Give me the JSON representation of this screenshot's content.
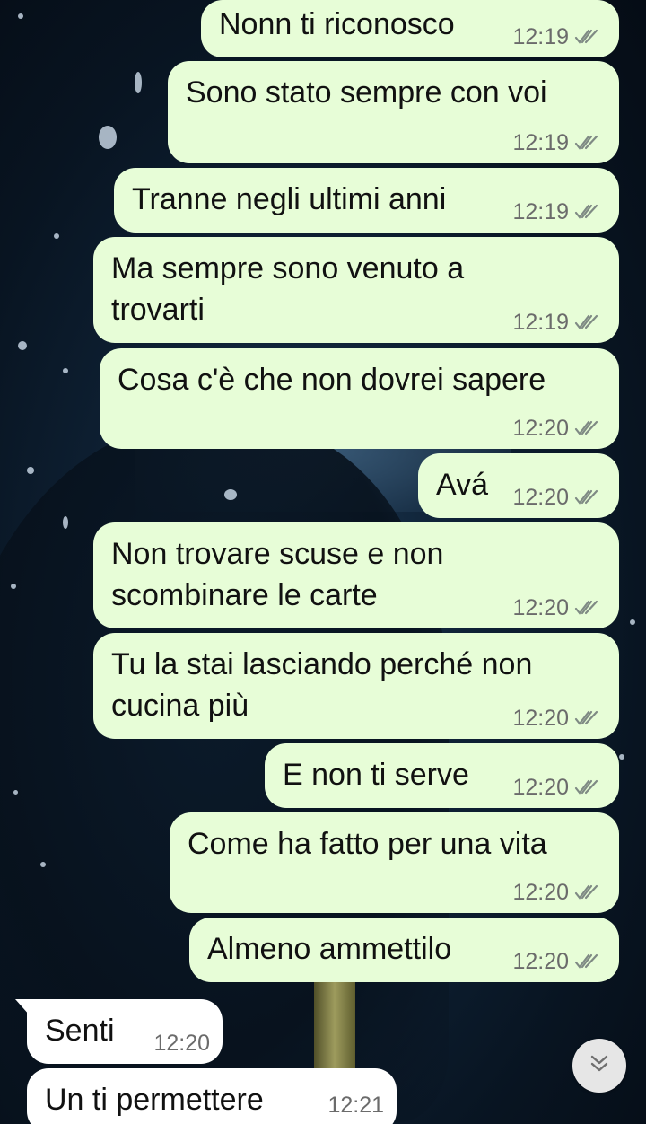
{
  "messages": [
    {
      "text": "Nonn ti riconosco",
      "time": "12:19",
      "direction": "outgoing",
      "status": "read"
    },
    {
      "text": "Sono stato sempre con voi",
      "time": "12:19",
      "direction": "outgoing",
      "status": "read"
    },
    {
      "text": "Tranne negli ultimi anni",
      "time": "12:19",
      "direction": "outgoing",
      "status": "read"
    },
    {
      "text": "Ma sempre sono venuto a",
      "text2": "trovarti",
      "time": "12:19",
      "direction": "outgoing",
      "status": "read"
    },
    {
      "text": "Cosa c'è che non dovrei sapere",
      "time": "12:20",
      "direction": "outgoing",
      "status": "read"
    },
    {
      "text": "Avá",
      "time": "12:20",
      "direction": "outgoing",
      "status": "read"
    },
    {
      "text": "Non trovare scuse e non",
      "text2": "scombinare le carte",
      "time": "12:20",
      "direction": "outgoing",
      "status": "read"
    },
    {
      "text": "Tu la stai lasciando perché non",
      "text2": "cucina più",
      "time": "12:20",
      "direction": "outgoing",
      "status": "read"
    },
    {
      "text": "E non ti serve",
      "time": "12:20",
      "direction": "outgoing",
      "status": "read"
    },
    {
      "text": "Come ha fatto per una vita",
      "time": "12:20",
      "direction": "outgoing",
      "status": "read"
    },
    {
      "text": "Almeno ammettilo",
      "time": "12:20",
      "direction": "outgoing",
      "status": "read"
    },
    {
      "text": "Senti",
      "time": "12:20",
      "direction": "incoming"
    },
    {
      "text": "Un ti permettere",
      "time": "12:21",
      "direction": "incoming"
    }
  ],
  "scroll_button": {
    "icon": "double-chevron-down-icon"
  },
  "colors": {
    "outgoing_bubble": "#e7fdd7",
    "incoming_bubble": "#ffffff",
    "read_ticks": "#7f8a84",
    "wallpaper": "#0f2236"
  }
}
